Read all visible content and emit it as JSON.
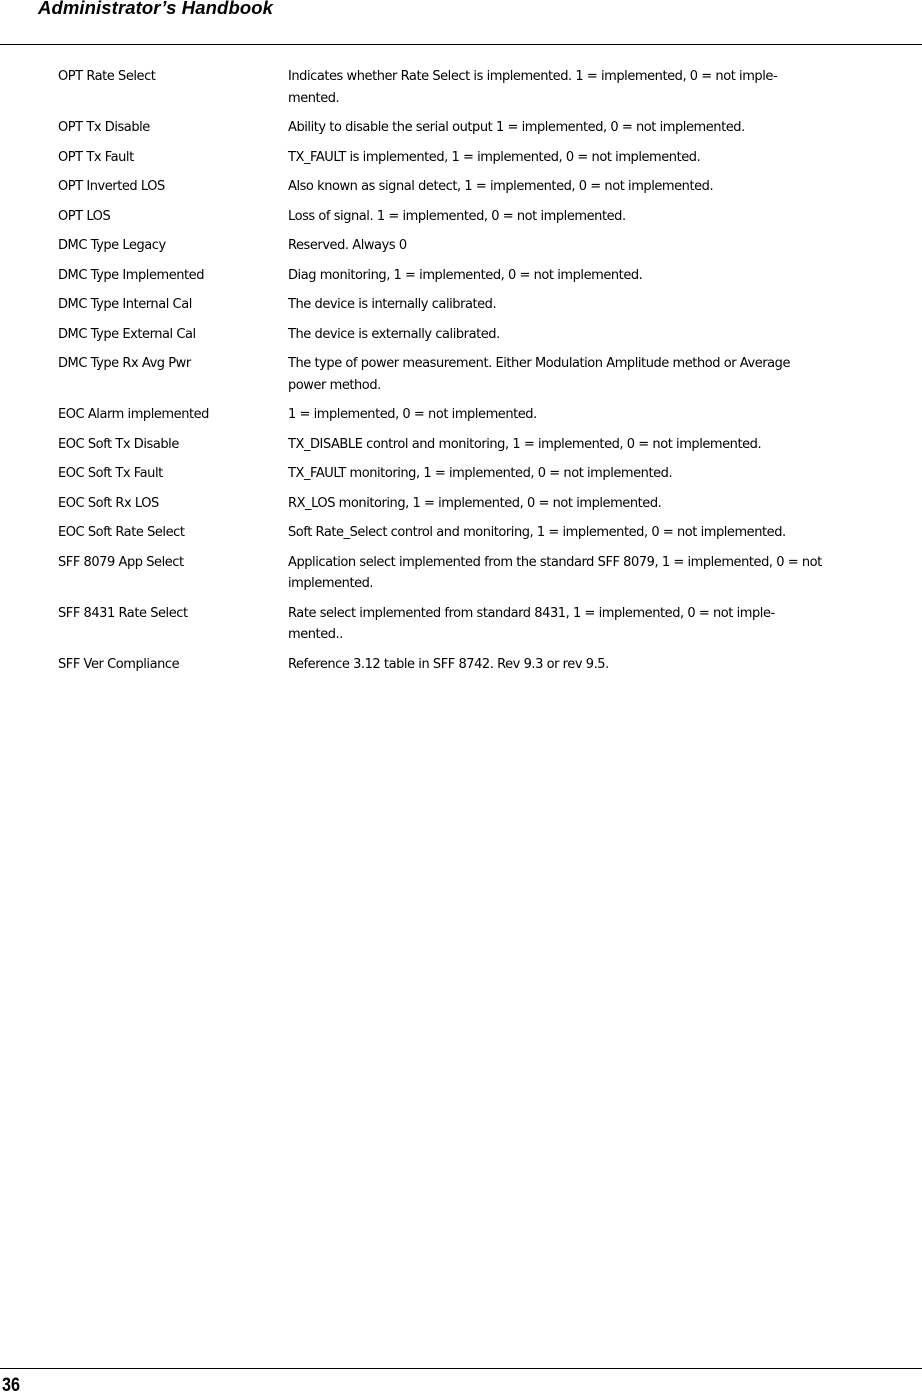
{
  "header": {
    "title": "Administrator’s Handbook"
  },
  "entries": [
    {
      "name": "OPT Rate Select",
      "description": "Indicates whether Rate Select is implemented. 1 = implemented, 0 = not imple-\nmented."
    },
    {
      "name": "OPT Tx Disable",
      "description": "Ability to disable the serial output 1 = implemented, 0 = not implemented."
    },
    {
      "name": "OPT Tx Fault",
      "description": "TX_FAULT is implemented, 1 = implemented, 0 = not implemented."
    },
    {
      "name": "OPT Inverted LOS",
      "description": "Also known as signal detect, 1 = implemented, 0 = not implemented."
    },
    {
      "name": "OPT LOS",
      "description": "Loss of signal. 1 = implemented, 0 = not implemented."
    },
    {
      "name": "DMC Type Legacy",
      "description": "Reserved. Always 0"
    },
    {
      "name": "DMC Type Implemented",
      "description": "Diag monitoring, 1 = implemented, 0 = not implemented."
    },
    {
      "name": "DMC Type Internal Cal",
      "description": "The device is internally calibrated."
    },
    {
      "name": "DMC Type External Cal",
      "description": "The device is externally calibrated."
    },
    {
      "name": "DMC Type Rx Avg Pwr",
      "description": "The type of power measurement. Either Modulation Amplitude method or Average\npower method."
    },
    {
      "name": "EOC Alarm implemented",
      "description": "1 = implemented, 0 = not implemented."
    },
    {
      "name": "EOC Soft Tx Disable",
      "description": "TX_DISABLE control and monitoring, 1 = implemented, 0 = not implemented."
    },
    {
      "name": "EOC Soft Tx Fault",
      "description": "TX_FAULT monitoring, 1 = implemented, 0 = not implemented."
    },
    {
      "name": "EOC Soft Rx LOS",
      "description": "RX_LOS monitoring, 1 = implemented, 0 = not implemented."
    },
    {
      "name": "EOC Soft Rate Select",
      "description": "Soft Rate_Select control and monitoring, 1 = implemented, 0 = not implemented."
    },
    {
      "name": "SFF 8079 App Select",
      "description": "Application select implemented from the standard SFF 8079, 1 = implemented, 0 = not\nimplemented."
    },
    {
      "name": "SFF 8431 Rate Select",
      "description": "Rate select implemented from standard 8431, 1 = implemented, 0 = not imple-\nmented.."
    },
    {
      "name": "SFF Ver Compliance",
      "description": "Reference 3.12 table in SFF 8742. Rev 9.3 or rev 9.5."
    }
  ],
  "footer": {
    "page_number": "36"
  }
}
